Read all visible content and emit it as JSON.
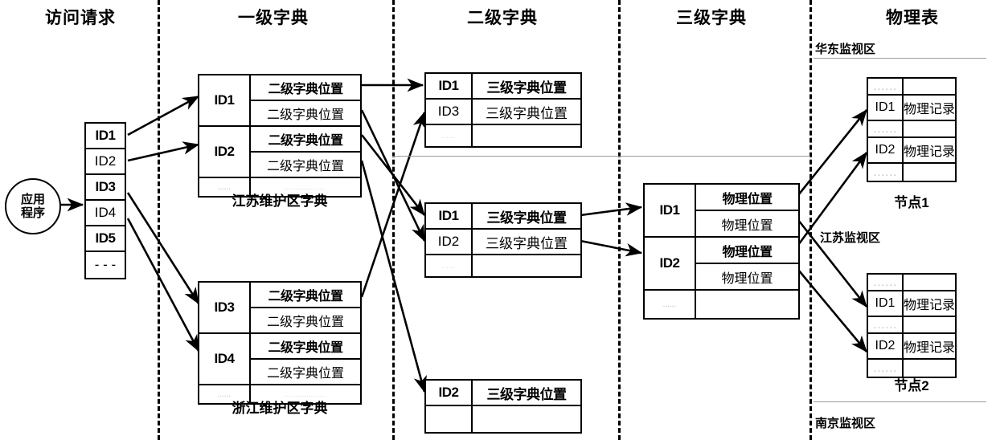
{
  "columns": [
    {
      "id": "access-request",
      "title": "访问请求"
    },
    {
      "id": "level1-dict",
      "title": "一级字典"
    },
    {
      "id": "level2-dict",
      "title": "二级字典"
    },
    {
      "id": "level3-dict",
      "title": "三级字典"
    },
    {
      "id": "physical-table",
      "title": "物理表"
    }
  ],
  "app": {
    "line1": "应用",
    "line2": "程序"
  },
  "id_list": {
    "rows": [
      {
        "label": "ID1",
        "highlight": true
      },
      {
        "label": "ID2",
        "highlight": false
      },
      {
        "label": "ID3",
        "highlight": true
      },
      {
        "label": "ID4",
        "highlight": false
      },
      {
        "label": "ID5",
        "highlight": true
      },
      {
        "label": "- - -",
        "highlight": false
      }
    ]
  },
  "level1": {
    "value_label": "二级字典位置",
    "ellipsis": "......",
    "dicts": [
      {
        "caption": "江苏维护区字典",
        "groups": [
          {
            "id": "ID1",
            "values": [
              "二级字典位置",
              "二级字典位置"
            ]
          },
          {
            "id": "ID2",
            "values": [
              "二级字典位置",
              "二级字典位置"
            ]
          }
        ],
        "tail": {
          "id": "......",
          "value": "..................."
        }
      },
      {
        "caption": "浙江维护区字典",
        "groups": [
          {
            "id": "ID3",
            "values": [
              "二级字典位置",
              "二级字典位置"
            ]
          },
          {
            "id": "ID4",
            "values": [
              "二级字典位置",
              "二级字典位置"
            ]
          }
        ],
        "tail": {
          "id": "......",
          "value": "..................."
        }
      }
    ]
  },
  "level2": {
    "value_label": "三级字典位置",
    "tables": [
      {
        "rows": [
          {
            "id": "ID1",
            "value": "三级字典位置",
            "bold": true
          },
          {
            "id": "ID3",
            "value": "三级字典位置",
            "bold": false
          },
          {
            "id": "......",
            "value": "",
            "faint": true
          }
        ]
      },
      {
        "rows": [
          {
            "id": "ID1",
            "value": "三级字典位置",
            "bold": true
          },
          {
            "id": "ID2",
            "value": "三级字典位置",
            "bold": false
          },
          {
            "id": "......",
            "value": "",
            "faint": true
          }
        ]
      },
      {
        "rows": [
          {
            "id": "ID2",
            "value": "三级字典位置",
            "bold": true
          },
          {
            "id": "",
            "value": "",
            "faint": false
          }
        ]
      }
    ]
  },
  "level3": {
    "value_label": "物理位置",
    "groups": [
      {
        "id": "ID1",
        "values": [
          "物理位置",
          "物理位置"
        ]
      },
      {
        "id": "ID2",
        "values": [
          "物理位置",
          "物理位置"
        ]
      }
    ],
    "tail": {
      "id": "......",
      "value": ""
    }
  },
  "physical": {
    "record_label": "物理记录",
    "regions": [
      {
        "name": "华东监视区"
      },
      {
        "name": "江苏监视区"
      },
      {
        "name": "南京监视区"
      }
    ],
    "nodes": [
      {
        "caption": "节点1",
        "rows": [
          {
            "id": "......",
            "value": "",
            "faint": true
          },
          {
            "id": "ID1",
            "value": "物理记录",
            "faint": false
          },
          {
            "id": "......",
            "value": "",
            "faint": true
          },
          {
            "id": "ID2",
            "value": "物理记录",
            "faint": false
          },
          {
            "id": "......",
            "value": "",
            "faint": true
          }
        ]
      },
      {
        "caption": "节点2",
        "rows": [
          {
            "id": "......",
            "value": "",
            "faint": true
          },
          {
            "id": "ID1",
            "value": "物理记录",
            "faint": false
          },
          {
            "id": "......",
            "value": "",
            "faint": true
          },
          {
            "id": "ID2",
            "value": "物理记录",
            "faint": false
          },
          {
            "id": "......",
            "value": "",
            "faint": true
          }
        ]
      }
    ]
  },
  "colors": {
    "line": "#000000",
    "rule": "#9a9a9a",
    "faint_text": "#c9c9c9"
  }
}
